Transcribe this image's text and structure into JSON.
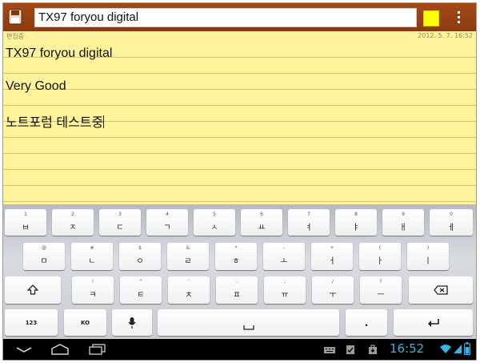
{
  "title_bar": {
    "title_value": "TX97 foryou digital",
    "color_swatch": "#ffff00"
  },
  "note": {
    "status_label": "편집중",
    "date": "2012. 5. 7. 16:52",
    "lines": [
      "TX97 foryou digital",
      "Very Good",
      "노트포럼 테스트중"
    ]
  },
  "keyboard": {
    "row1": [
      {
        "hint": "1",
        "main": "ㅂ"
      },
      {
        "hint": "2",
        "main": "ㅈ"
      },
      {
        "hint": "3",
        "main": "ㄷ"
      },
      {
        "hint": "4",
        "main": "ㄱ"
      },
      {
        "hint": "5",
        "main": "ㅅ"
      },
      {
        "hint": "6",
        "main": "ㅛ"
      },
      {
        "hint": "7",
        "main": "ㅕ"
      },
      {
        "hint": "8",
        "main": "ㅑ"
      },
      {
        "hint": "9",
        "main": "ㅐ"
      },
      {
        "hint": "0",
        "main": "ㅔ"
      }
    ],
    "row2": [
      {
        "hint": "@",
        "main": "ㅁ"
      },
      {
        "hint": "#",
        "main": "ㄴ"
      },
      {
        "hint": "$",
        "main": "ㅇ"
      },
      {
        "hint": "&",
        "main": "ㄹ"
      },
      {
        "hint": "*",
        "main": "ㅎ"
      },
      {
        "hint": "-",
        "main": "ㅗ"
      },
      {
        "hint": "+",
        "main": "ㅓ"
      },
      {
        "hint": "(",
        "main": "ㅏ"
      },
      {
        "hint": ")",
        "main": "ㅣ"
      }
    ],
    "row3": [
      {
        "hint": "!",
        "main": "ㅋ"
      },
      {
        "hint": "\"",
        "main": "ㅌ"
      },
      {
        "hint": "'",
        "main": "ㅊ"
      },
      {
        "hint": ":",
        "main": "ㅍ"
      },
      {
        "hint": ";",
        "main": "ㅠ"
      },
      {
        "hint": "/",
        "main": "ㅜ"
      },
      {
        "hint": "?",
        "main": "ㅡ"
      }
    ],
    "symbols_label": "123",
    "language_label": "KO",
    "period_label": "."
  },
  "status": {
    "clock": "16:52"
  },
  "colors": {
    "title_bar": "#9a4214",
    "note_paper": "#fff49c",
    "clock": "#35b5e5"
  }
}
